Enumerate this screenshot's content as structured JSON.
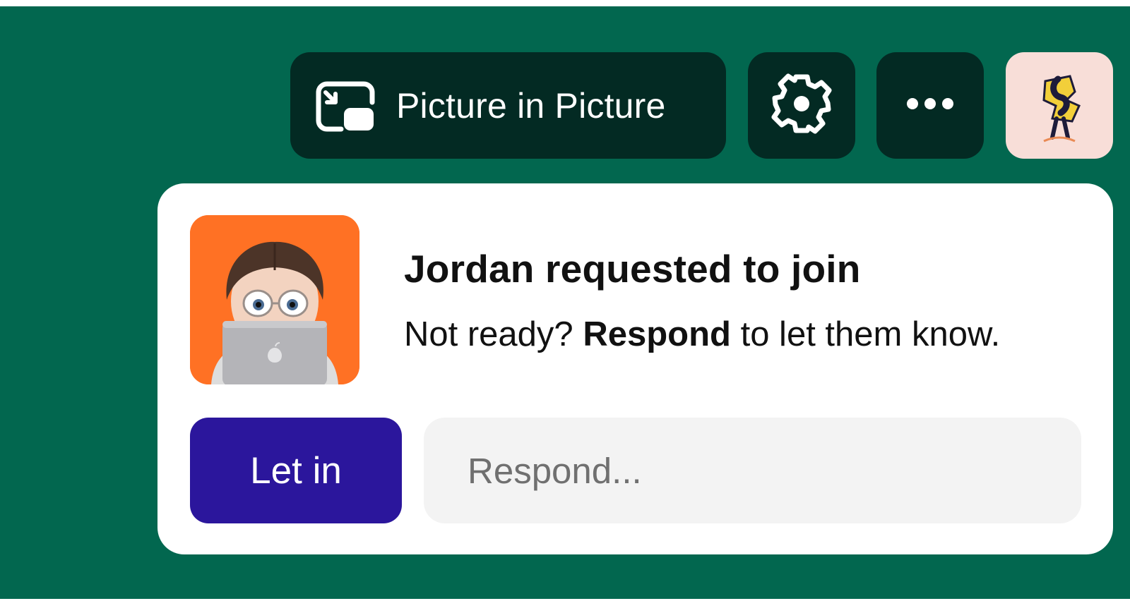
{
  "toolbar": {
    "pip_label": "Picture in Picture",
    "pip_icon": "picture-in-picture-icon",
    "settings_icon": "gear-icon",
    "more_icon": "more-horizontal-icon",
    "user_avatar": "user-avatar-illustration"
  },
  "join_request": {
    "title": "Jordan requested to join",
    "subtitle_prefix": "Not ready?",
    "subtitle_emphasis": "Respond",
    "subtitle_suffix": "to let them know.",
    "avatar": "memoji-avatar-with-laptop",
    "let_in_label": "Let in",
    "respond_placeholder": "Respond..."
  },
  "colors": {
    "background": "#02674f",
    "toolbar_button": "#032a23",
    "card": "#ffffff",
    "primary_button": "#2b169c",
    "requester_avatar_bg": "#ff7124",
    "user_avatar_bg": "#f8ded8",
    "input_bg": "#f3f3f3"
  }
}
